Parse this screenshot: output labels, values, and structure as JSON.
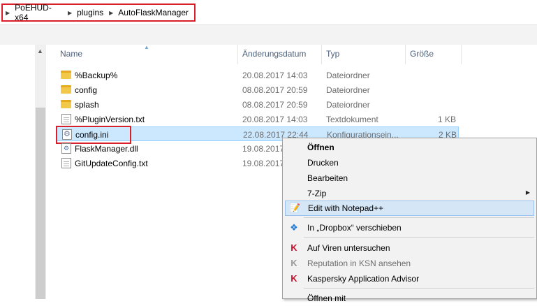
{
  "breadcrumb": [
    "PoEHUD-x64",
    "plugins",
    "AutoFlaskManager"
  ],
  "columns": {
    "name": "Name",
    "date": "Änderungsdatum",
    "type": "Typ",
    "size": "Größe"
  },
  "files": [
    {
      "name": "%Backup%",
      "date": "20.08.2017 14:03",
      "type": "Dateiordner",
      "size": "",
      "icon": "folder-icon"
    },
    {
      "name": "config",
      "date": "08.08.2017 20:59",
      "type": "Dateiordner",
      "size": "",
      "icon": "folder-icon"
    },
    {
      "name": "splash",
      "date": "08.08.2017 20:59",
      "type": "Dateiordner",
      "size": "",
      "icon": "folder-icon"
    },
    {
      "name": "%PluginVersion.txt",
      "date": "20.08.2017 14:03",
      "type": "Textdokument",
      "size": "1 KB",
      "icon": "text-file-icon"
    },
    {
      "name": "config.ini",
      "date": "22.08.2017 22:44",
      "type": "Konfigurationsein...",
      "size": "2 KB",
      "icon": "settings-file-icon"
    },
    {
      "name": "FlaskManager.dll",
      "date": "19.08.2017",
      "type": "",
      "size": "",
      "icon": "dll-file-icon"
    },
    {
      "name": "GitUpdateConfig.txt",
      "date": "19.08.2017",
      "type": "",
      "size": "",
      "icon": "text-file-icon"
    }
  ],
  "context_menu": [
    {
      "label": "Öffnen",
      "icon": "",
      "bold": true
    },
    {
      "label": "Drucken",
      "icon": ""
    },
    {
      "label": "Bearbeiten",
      "icon": ""
    },
    {
      "label": "7-Zip",
      "icon": "",
      "submenu": true
    },
    {
      "label": "Edit with Notepad++",
      "icon": "notepad-plus-plus-icon",
      "hover": true
    },
    {
      "label": "In „Dropbox“ verschieben",
      "icon": "dropbox-icon"
    },
    {
      "label": "Auf Viren untersuchen",
      "icon": "kaspersky-icon"
    },
    {
      "label": "Reputation in KSN ansehen",
      "icon": "kaspersky-icon",
      "disabled": true
    },
    {
      "label": "Kaspersky Application Advisor",
      "icon": "kaspersky-icon"
    },
    {
      "label": "Öffnen mit",
      "icon": ""
    }
  ],
  "colors": {
    "selection": "#cce8ff",
    "highlight_border": "#d9202a",
    "menu_hover": "#d5e6f7"
  }
}
